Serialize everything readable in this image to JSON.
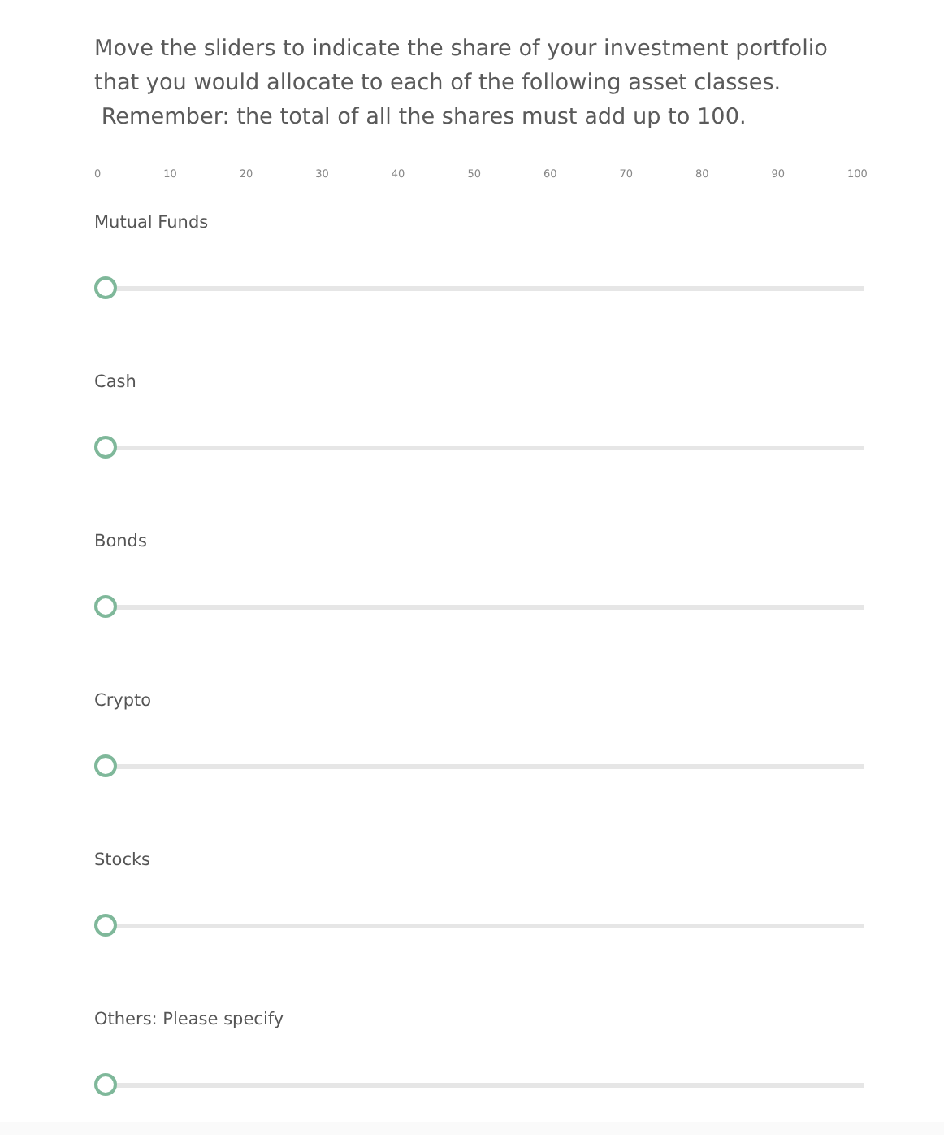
{
  "question": "Move the sliders to indicate the share of your investment portfolio\nthat you would allocate to each of the following asset classes.\n Remember: the total of all the shares must add up to 100.",
  "scale": [
    "0",
    "10",
    "20",
    "30",
    "40",
    "50",
    "60",
    "70",
    "80",
    "90",
    "100"
  ],
  "sliders": [
    {
      "label": "Mutual Funds",
      "level": 0
    },
    {
      "label": "Cash",
      "level": 0
    },
    {
      "label": "Bonds",
      "level": 0
    },
    {
      "label": "Crypto",
      "level": 0
    },
    {
      "label": "Stocks",
      "level": 0
    },
    {
      "label": "Others: Please specify",
      "level": 0
    }
  ]
}
